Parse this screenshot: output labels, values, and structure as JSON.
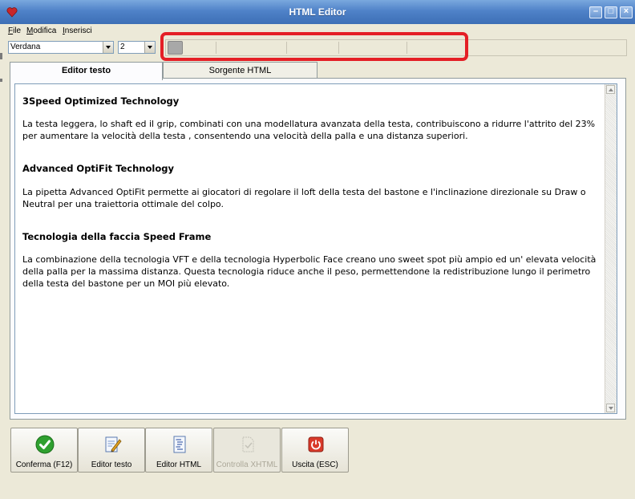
{
  "window": {
    "title": "HTML Editor"
  },
  "menu": {
    "items": [
      "File",
      "Modifica",
      "Inserisci"
    ]
  },
  "toolbar": {
    "font": "Verdana",
    "size": "2"
  },
  "tabs": [
    {
      "label": "Editor testo",
      "active": true
    },
    {
      "label": "Sorgente HTML",
      "active": false
    }
  ],
  "editor": {
    "sections": [
      {
        "heading": "3Speed Optimized Technology",
        "body": "La testa leggera, lo shaft ed il grip, combinati con una modellatura avanzata della testa, contribuiscono a ridurre l'attrito del 23% per aumentare la velocità della testa , consentendo una velocità della palla e una distanza superiori."
      },
      {
        "heading": "Advanced OptiFit Technology",
        "body": "La pipetta Advanced OptiFit permette ai giocatori di regolare il loft della testa del bastone e l'inclinazione direzionale su Draw o Neutral per una traiettoria ottimale del colpo."
      },
      {
        "heading": "Tecnologia della faccia Speed Frame",
        "body": "La combinazione della tecnologia VFT e della tecnologia Hyperbolic Face creano uno sweet spot più ampio ed un' elevata velocità della palla per la massima distanza. Questa tecnologia riduce anche il peso, permettendone la redistribuzione lungo il perimetro della testa del bastone per un MOI più elevato."
      }
    ]
  },
  "buttons": [
    {
      "label": "Conferma (F12)",
      "icon": "confirm-check-icon",
      "enabled": true
    },
    {
      "label": "Editor testo",
      "icon": "edit-document-icon",
      "enabled": true
    },
    {
      "label": "Editor HTML",
      "icon": "html-document-icon",
      "enabled": true
    },
    {
      "label": "Controlla XHTML",
      "icon": "validate-xhtml-icon",
      "enabled": false
    },
    {
      "label": "Uscita (ESC)",
      "icon": "exit-power-icon",
      "enabled": true
    }
  ],
  "colors": {
    "titlebar": "#4f82c8",
    "highlight": "#e41f26",
    "confirm": "#2fa02f",
    "exit": "#d93a2a"
  }
}
